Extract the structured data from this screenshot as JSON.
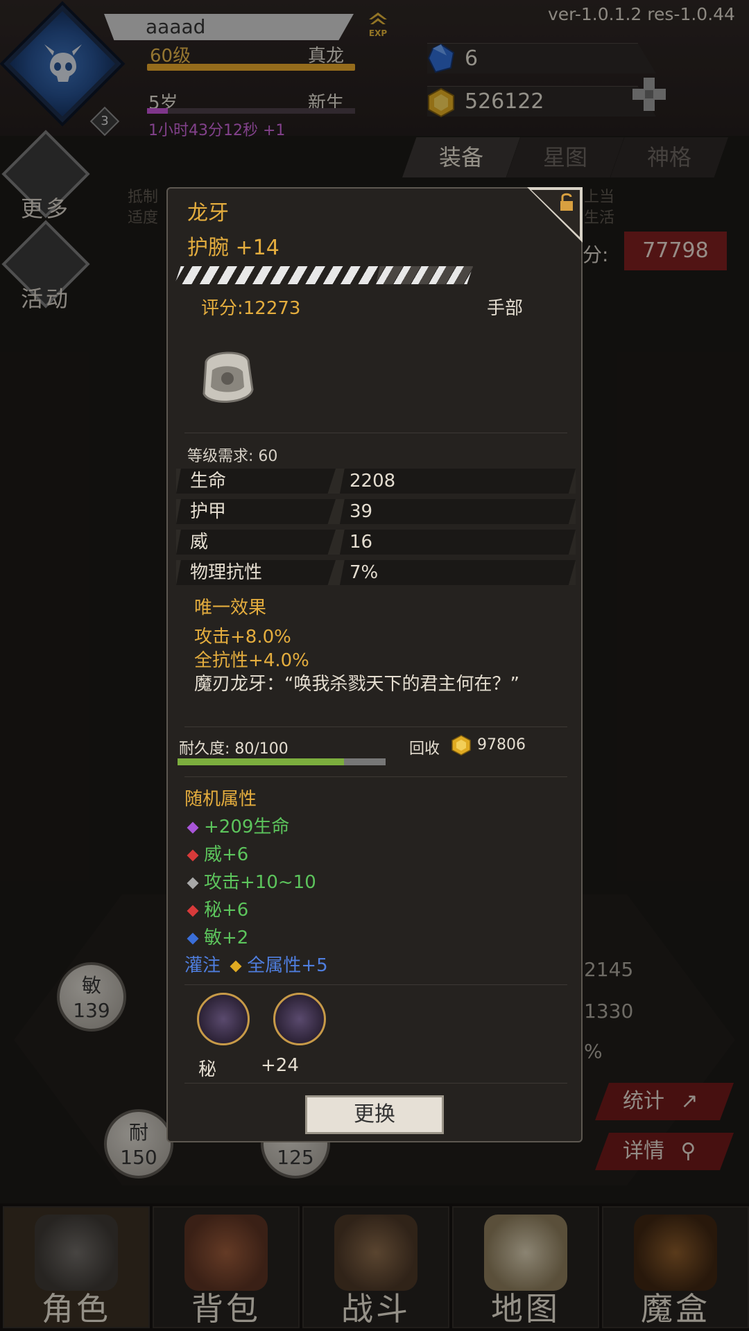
{
  "header": {
    "player_name": "aaaad",
    "level": "60级",
    "title": "真龙",
    "age": "5岁",
    "stage": "新生",
    "timer": "1小时43分12秒 +1",
    "avatar_badge": "3",
    "exp_label": "EXP",
    "version": "ver-1.0.1.2  res-1.0.44",
    "gems": "6",
    "gold": "526122",
    "level_progress": 1.0,
    "age_progress": 0.1
  },
  "side_buttons": [
    {
      "label": "更多",
      "icon": "more-icon"
    },
    {
      "label": "活动",
      "icon": "activity-icon"
    }
  ],
  "tabs": [
    {
      "label": "装备",
      "active": true
    },
    {
      "label": "星图",
      "active": false
    },
    {
      "label": "神格",
      "active": false
    }
  ],
  "background": {
    "text_line1": "抵制",
    "text_line2": "适度",
    "text_right1": "上当",
    "text_right2": "生活",
    "score_prefix": "分:",
    "score_value": "77798",
    "stat_agi_label": "敏",
    "stat_agi_value": "139",
    "stat_end_label": "耐",
    "stat_end_value": "150",
    "stat_3_value": "125",
    "num1": "2145",
    "num2": "1330",
    "num3": "%",
    "stats_btn": "统计",
    "detail_btn": "详情"
  },
  "popup": {
    "name": "龙牙",
    "type": "护腕 +14",
    "score": "评分:12273",
    "slot": "手部",
    "quality_progress": 0.67,
    "level_req": "等级需求: 60",
    "stats": [
      {
        "label": "生命",
        "value": "2208"
      },
      {
        "label": "护甲",
        "value": "39"
      },
      {
        "label": "威",
        "value": "16"
      },
      {
        "label": "物理抗性",
        "value": "7%"
      }
    ],
    "unique_title": "唯一效果",
    "unique_effects": [
      "攻击+8.0%",
      "全抗性+4.0%"
    ],
    "unique_quote": "魔刃龙牙：“唤我杀戮天下的君主何在？”",
    "durability": "耐久度: 80/100",
    "durability_ratio": 0.8,
    "recycle_label": "回收",
    "recycle_value": "97806",
    "random_title": "随机属性",
    "random_attrs": [
      {
        "text": "+209生命",
        "color": "#a855d8"
      },
      {
        "text": "威+6",
        "color": "#d83a3a"
      },
      {
        "text": "攻击+10~10",
        "color": "#a8a8a8"
      },
      {
        "text": "秘+6",
        "color": "#d83a3a"
      },
      {
        "text": "敏+2",
        "color": "#3a6ed8"
      }
    ],
    "infuse_label": "灌注",
    "infuse_value": "全属性+5",
    "sockets": [
      {
        "label": "秘"
      },
      {
        "label": "+24"
      }
    ],
    "replace_button": "更换"
  },
  "bottom_nav": [
    {
      "label": "角色",
      "icon": "helmet-icon",
      "active": true
    },
    {
      "label": "背包",
      "icon": "backpack-icon",
      "active": false
    },
    {
      "label": "战斗",
      "icon": "sword-shield-icon",
      "active": false
    },
    {
      "label": "地图",
      "icon": "scroll-map-icon",
      "active": false
    },
    {
      "label": "魔盒",
      "icon": "magic-box-icon",
      "active": false
    }
  ],
  "colors": {
    "gold_text": "#e4ad3e",
    "green_attr": "#5cc45c",
    "blue_infuse": "#4f7ede",
    "red_button": "#6e1a1a"
  }
}
